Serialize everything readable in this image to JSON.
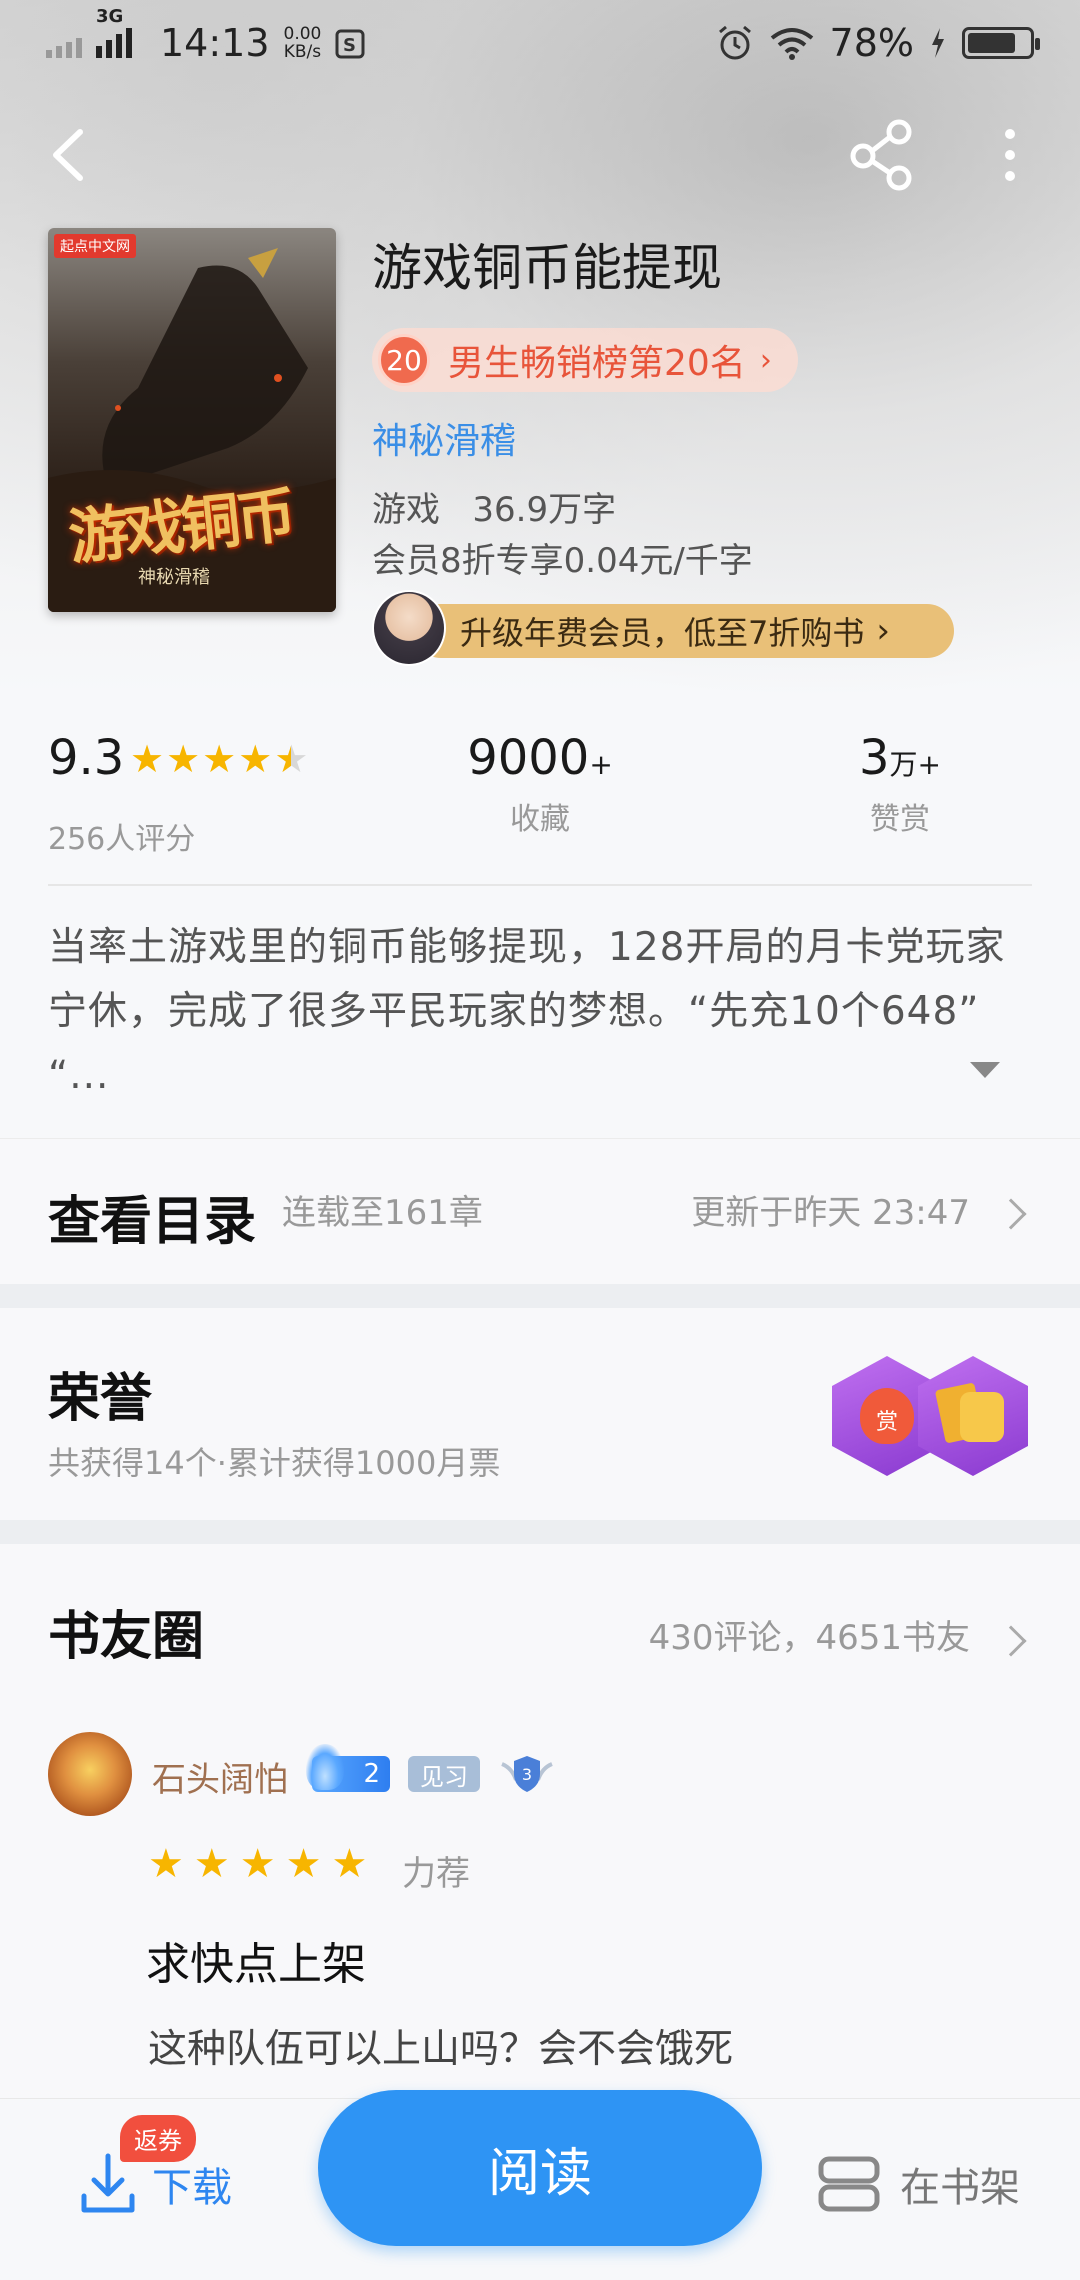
{
  "status_bar": {
    "network": "3G",
    "time": "14:13",
    "speed_value": "0.00",
    "speed_unit": "KB/s",
    "battery": "78%",
    "battery_level": 0.78
  },
  "book": {
    "title": "游戏铜币能提现",
    "cover_title": "游戏铜币",
    "cover_author": "神秘滑稽",
    "cover_brand": "起点中文网",
    "rank_number": "20",
    "rank_text": "男生畅销榜第20名",
    "author": "神秘滑稽",
    "genre_words": "游戏   36.9万字",
    "member_price": "会员8折专享0.04元/千字",
    "vip_promo": "升级年费会员，低至7折购书"
  },
  "stats": {
    "score": "9.3",
    "rating_stars": 4.5,
    "raters": "256人评分",
    "favorites_value": "9000",
    "favorites_suffix": "+",
    "favorites_label": "收藏",
    "rewards_value": "3",
    "rewards_suffix": "万+",
    "rewards_label": "赞赏"
  },
  "synopsis": "当率土游戏里的铜币能够提现，128开局的月卡党玩家宁休，完成了很多平民玩家的梦想。“先充10个648” “...",
  "toc": {
    "title": "查看目录",
    "serial": "连载至161章",
    "updated": "更新于昨天 23:47"
  },
  "honor": {
    "title": "荣誉",
    "summary": "共获得14个·累计获得1000月票",
    "badge1_text": "赏"
  },
  "circle": {
    "title": "书友圈",
    "stats": "430评论，4651书友",
    "comment": {
      "user": "石头阔怕",
      "fan_level": "2",
      "tag": "见习",
      "shield_level": "3",
      "rating_label": "力荐",
      "stars": 5,
      "title": "求快点上架",
      "body": "这种队伍可以上山吗？会不会饿死"
    }
  },
  "bottom_bar": {
    "refund_tag": "返券",
    "download": "下载",
    "read": "阅读",
    "on_shelf": "在书架"
  },
  "colors": {
    "accent_blue": "#2e94f4",
    "rank_red": "#e8543a",
    "star_gold": "#f7b500",
    "vip_gold": "#e9c078"
  }
}
